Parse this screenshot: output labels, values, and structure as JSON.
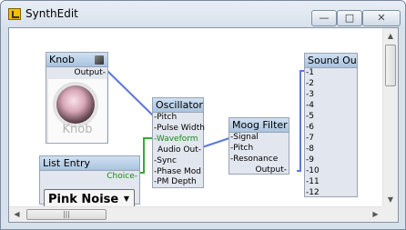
{
  "window": {
    "title": "SynthEdit"
  },
  "controls": {
    "minimize": "—",
    "maximize": "□",
    "close": "✕"
  },
  "modules": {
    "knob": {
      "title": "Knob",
      "output": "Output-",
      "label": "Knob",
      "icon": "cube-icon"
    },
    "list_entry": {
      "title": "List Entry",
      "choice": "Choice-",
      "selected": "Pink Noise"
    },
    "oscillator": {
      "title": "Oscillator",
      "inputs": [
        "-Pitch",
        "-Pulse Width",
        "-Waveform",
        "Audio Out-",
        "-Sync",
        "-Phase Mod",
        "-PM Depth"
      ]
    },
    "moog_filter": {
      "title": "Moog Filter",
      "inputs": [
        "-Signal",
        "-Pitch",
        "-Resonance",
        "Output-"
      ]
    },
    "sound_out": {
      "title": "Sound Out",
      "pins": [
        "-1",
        "-2",
        "-3",
        "-4",
        "-5",
        "-6",
        "-7",
        "-8",
        "-9",
        "-10",
        "-11",
        "-12"
      ]
    }
  },
  "colors": {
    "wire_blue": "#5b78d8",
    "wire_green": "#3aa83a"
  },
  "scrollbar": {
    "grip": "|||"
  }
}
